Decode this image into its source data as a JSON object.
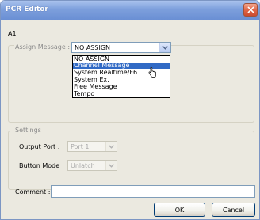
{
  "window": {
    "title": "PCR Editor"
  },
  "pad_label": "A1",
  "assign": {
    "label": "Assign Message :",
    "value": "NO ASSIGN",
    "options": [
      "NO ASSIGN",
      "Channel Message",
      "System Realtime/F6",
      "System Ex.",
      "Free Message",
      "Tempo"
    ],
    "highlighted": "Channel Message"
  },
  "settings": {
    "title": "Settings",
    "output_port": {
      "label": "Output Port :",
      "value": "Port 1"
    },
    "button_mode": {
      "label": "Button Mode",
      "value": "Unlatch"
    }
  },
  "comment": {
    "label": "Comment :",
    "value": ""
  },
  "buttons": {
    "ok": "OK",
    "cancel": "Cancel"
  },
  "colors": {
    "title_bar": "#7d9fdc",
    "close_button": "#e0674a",
    "selection": "#316ac5",
    "dialog_bg": "#ebe9e0"
  },
  "icons": {
    "close": "close-icon",
    "dropdown": "chevron-down-icon",
    "pointer": "hand-cursor-icon"
  }
}
